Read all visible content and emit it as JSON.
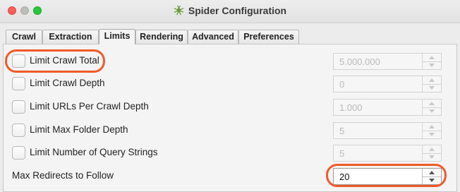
{
  "window": {
    "title": "Spider Configuration",
    "app_icon": "spider-icon"
  },
  "tabs": [
    {
      "label": "Crawl",
      "active": false
    },
    {
      "label": "Extraction",
      "active": false
    },
    {
      "label": "Limits",
      "active": true
    },
    {
      "label": "Rendering",
      "active": false
    },
    {
      "label": "Advanced",
      "active": false
    },
    {
      "label": "Preferences",
      "active": false
    }
  ],
  "limits": [
    {
      "label": "Limit Crawl Total",
      "checked": false,
      "value": "5.000.000",
      "enabled": false
    },
    {
      "label": "Limit Crawl Depth",
      "checked": false,
      "value": "0",
      "enabled": false
    },
    {
      "label": "Limit URLs Per Crawl Depth",
      "checked": false,
      "value": "1.000",
      "enabled": false
    },
    {
      "label": "Limit Max Folder Depth",
      "checked": false,
      "value": "5",
      "enabled": false
    },
    {
      "label": "Limit Number of Query Strings",
      "checked": false,
      "value": "5",
      "enabled": false
    }
  ],
  "max_redirects": {
    "label": "Max Redirects to Follow",
    "value": "20",
    "enabled": true
  },
  "colors": {
    "highlight": "#f05a28"
  }
}
